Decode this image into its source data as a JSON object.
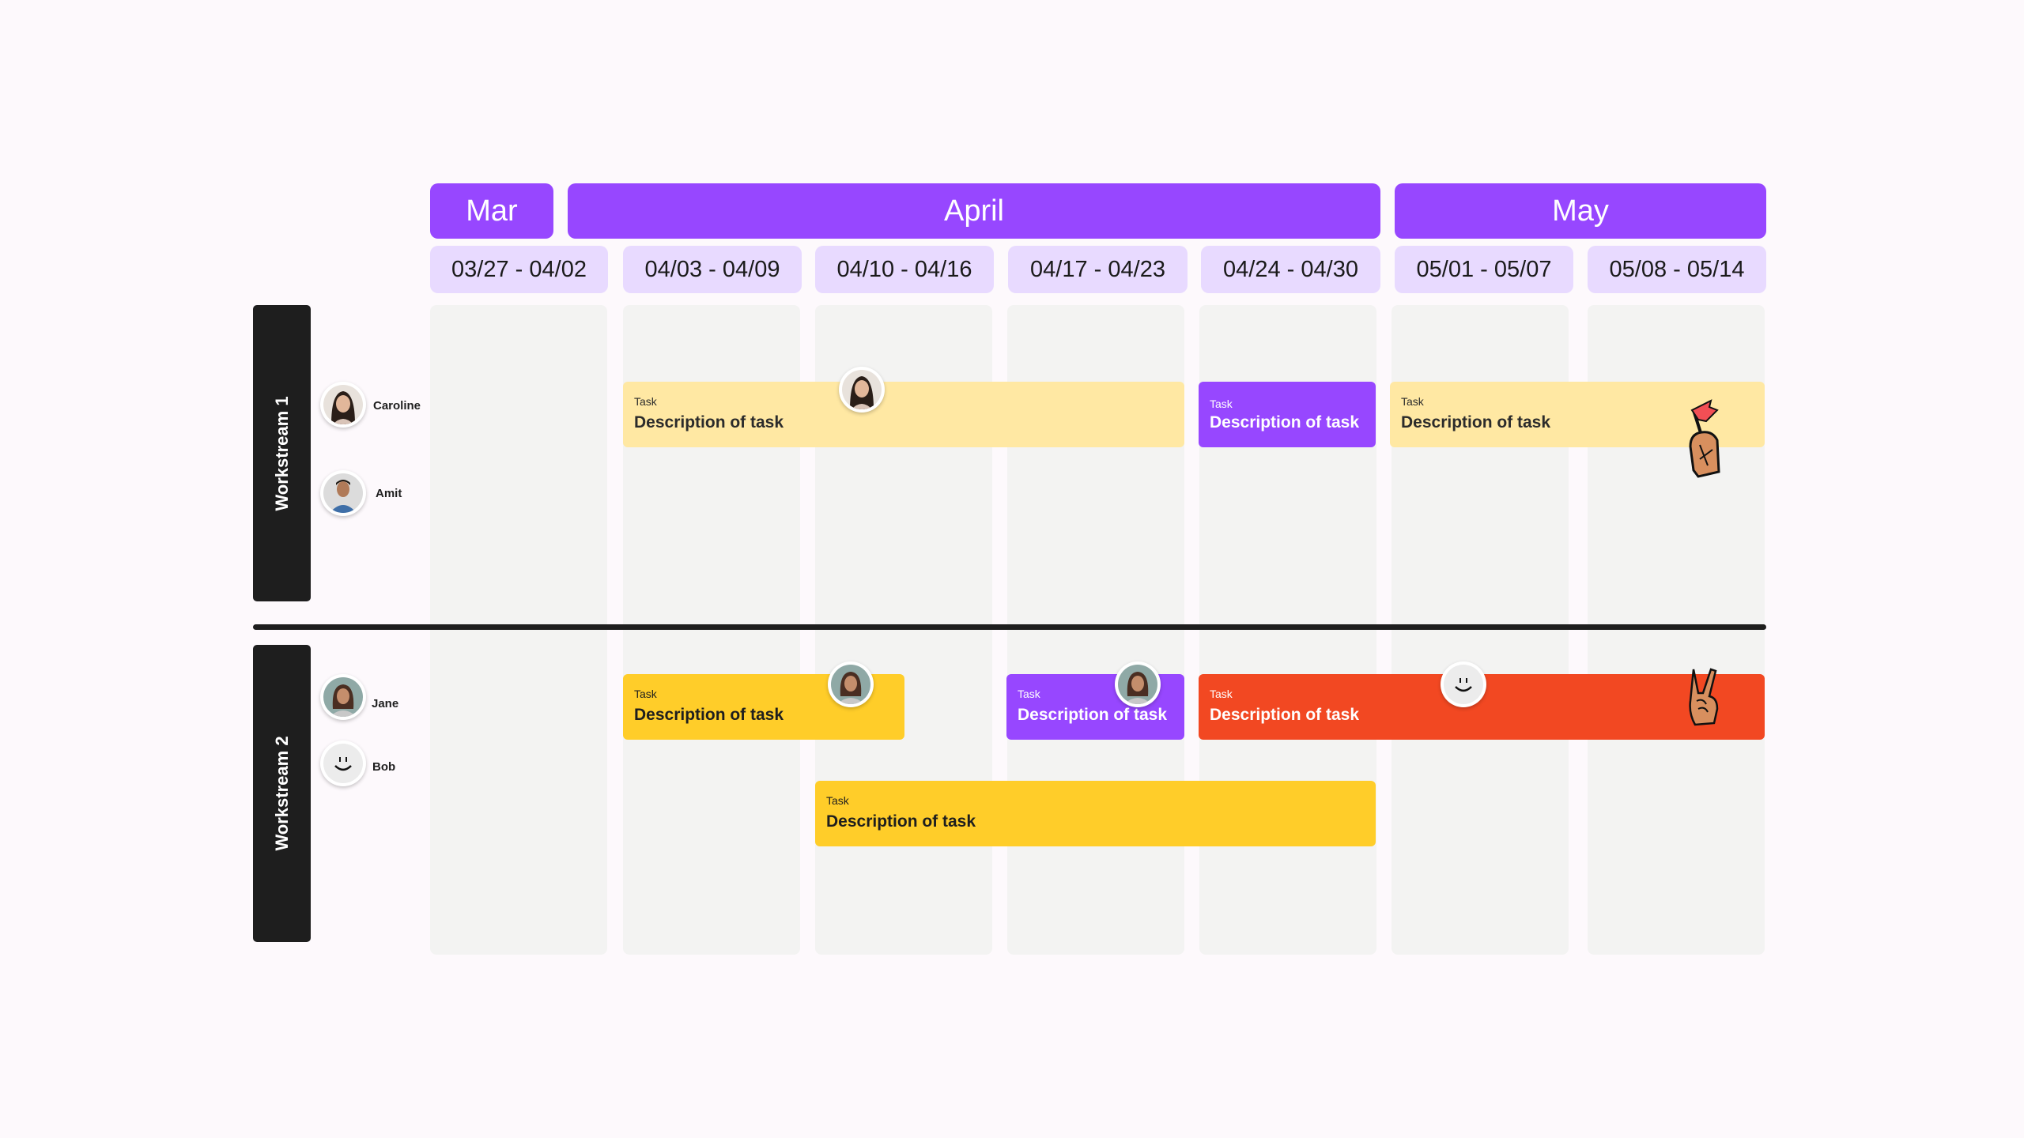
{
  "colors": {
    "month_bg": "#9747ff",
    "week_bg": "#e8daff",
    "column_bg": "#f3f3f2",
    "workstream_bg": "#1e1e1e",
    "task_light_yellow": "#ffe8a3",
    "task_yellow": "#ffcd29",
    "task_purple": "#9747ff",
    "task_orange": "#f24822"
  },
  "months": [
    {
      "label": "Mar"
    },
    {
      "label": "April"
    },
    {
      "label": "May"
    }
  ],
  "weeks": [
    {
      "label": "03/27 - 04/02"
    },
    {
      "label": "04/03 - 04/09"
    },
    {
      "label": "04/10 - 04/16"
    },
    {
      "label": "04/17 - 04/23"
    },
    {
      "label": "04/24 - 04/30"
    },
    {
      "label": "05/01 - 05/07"
    },
    {
      "label": "05/08 - 05/14"
    }
  ],
  "workstreams": [
    {
      "label": "Workstream 1",
      "people": [
        {
          "name": "Caroline",
          "avatar": "photo-woman-dark-hair"
        },
        {
          "name": "Amit",
          "avatar": "photo-man-blue-shirt"
        }
      ],
      "tasks": [
        {
          "label": "Task",
          "description": "Description of task",
          "start_week": "04/03 - 04/09",
          "end_week": "04/24 - 04/30",
          "color": "light-yellow",
          "assignee": "Caroline"
        },
        {
          "label": "Task",
          "description": "Description of task",
          "start_week": "04/24 - 04/30",
          "end_week": "04/24 - 04/30",
          "color": "purple"
        },
        {
          "label": "Task",
          "description": "Description of task",
          "start_week": "05/01 - 05/07",
          "end_week": "05/08 - 05/14",
          "color": "light-yellow",
          "sticker": "hand-holding-flag"
        }
      ]
    },
    {
      "label": "Workstream 2",
      "people": [
        {
          "name": "Jane",
          "avatar": "photo-woman-curly-hair"
        },
        {
          "name": "Bob",
          "avatar": "smiley-face"
        }
      ],
      "tasks": [
        {
          "label": "Task",
          "description": "Description of task",
          "start_week": "04/03 - 04/09",
          "end_week": "04/10 - 04/16",
          "color": "yellow",
          "assignee": "Jane"
        },
        {
          "label": "Task",
          "description": "Description of task",
          "start_week": "04/17 - 04/23",
          "end_week": "04/17 - 04/23",
          "color": "purple",
          "assignee": "Jane"
        },
        {
          "label": "Task",
          "description": "Description of task",
          "start_week": "04/24 - 04/30",
          "end_week": "05/08 - 05/14",
          "color": "orange",
          "assignee": "Bob",
          "sticker": "peace-sign-hand"
        },
        {
          "label": "Task",
          "description": "Description of task",
          "start_week": "04/10 - 04/16",
          "end_week": "04/24 - 04/30",
          "color": "yellow"
        }
      ]
    }
  ]
}
